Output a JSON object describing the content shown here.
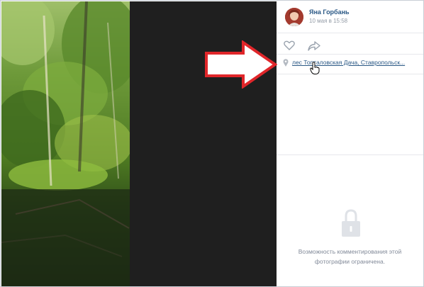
{
  "post": {
    "author_name": "Яна Горбань",
    "date": "10 мая в 15:58",
    "location": "лес Топталовская Дача, Ставропольск..."
  },
  "comments": {
    "restricted_text_line1": "Возможность комментирования этой",
    "restricted_text_line2": "фотографии ограничена."
  },
  "icons": {
    "like": "heart-outline-icon",
    "share": "share-arrow-icon",
    "location": "location-pin-icon",
    "lock": "lock-icon",
    "annotation": "red-arrow",
    "cursor": "hand-pointer-cursor"
  },
  "colors": {
    "link": "#2a5885",
    "muted": "#828a99",
    "annotation_red": "#e0262a",
    "dark_area": "#1f1f1f"
  }
}
